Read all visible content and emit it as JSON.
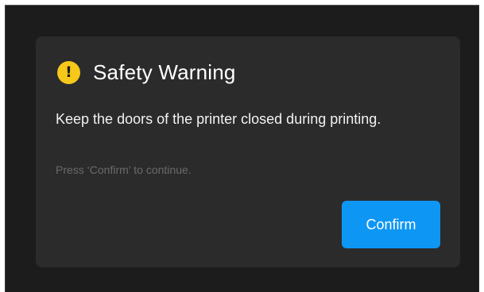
{
  "dialog": {
    "icon": "exclamation-warning-icon",
    "icon_glyph": "!",
    "title": "Safety Warning",
    "message": "Keep the doors of the printer closed during printing.",
    "hint": "Press ‘Confirm’ to continue.",
    "confirm_label": "Confirm"
  },
  "colors": {
    "background": "#1c1c1c",
    "dialog": "#2b2b2b",
    "warning": "#f6c81a",
    "accent": "#0e96f4",
    "hint_text": "#6a6a6a"
  }
}
